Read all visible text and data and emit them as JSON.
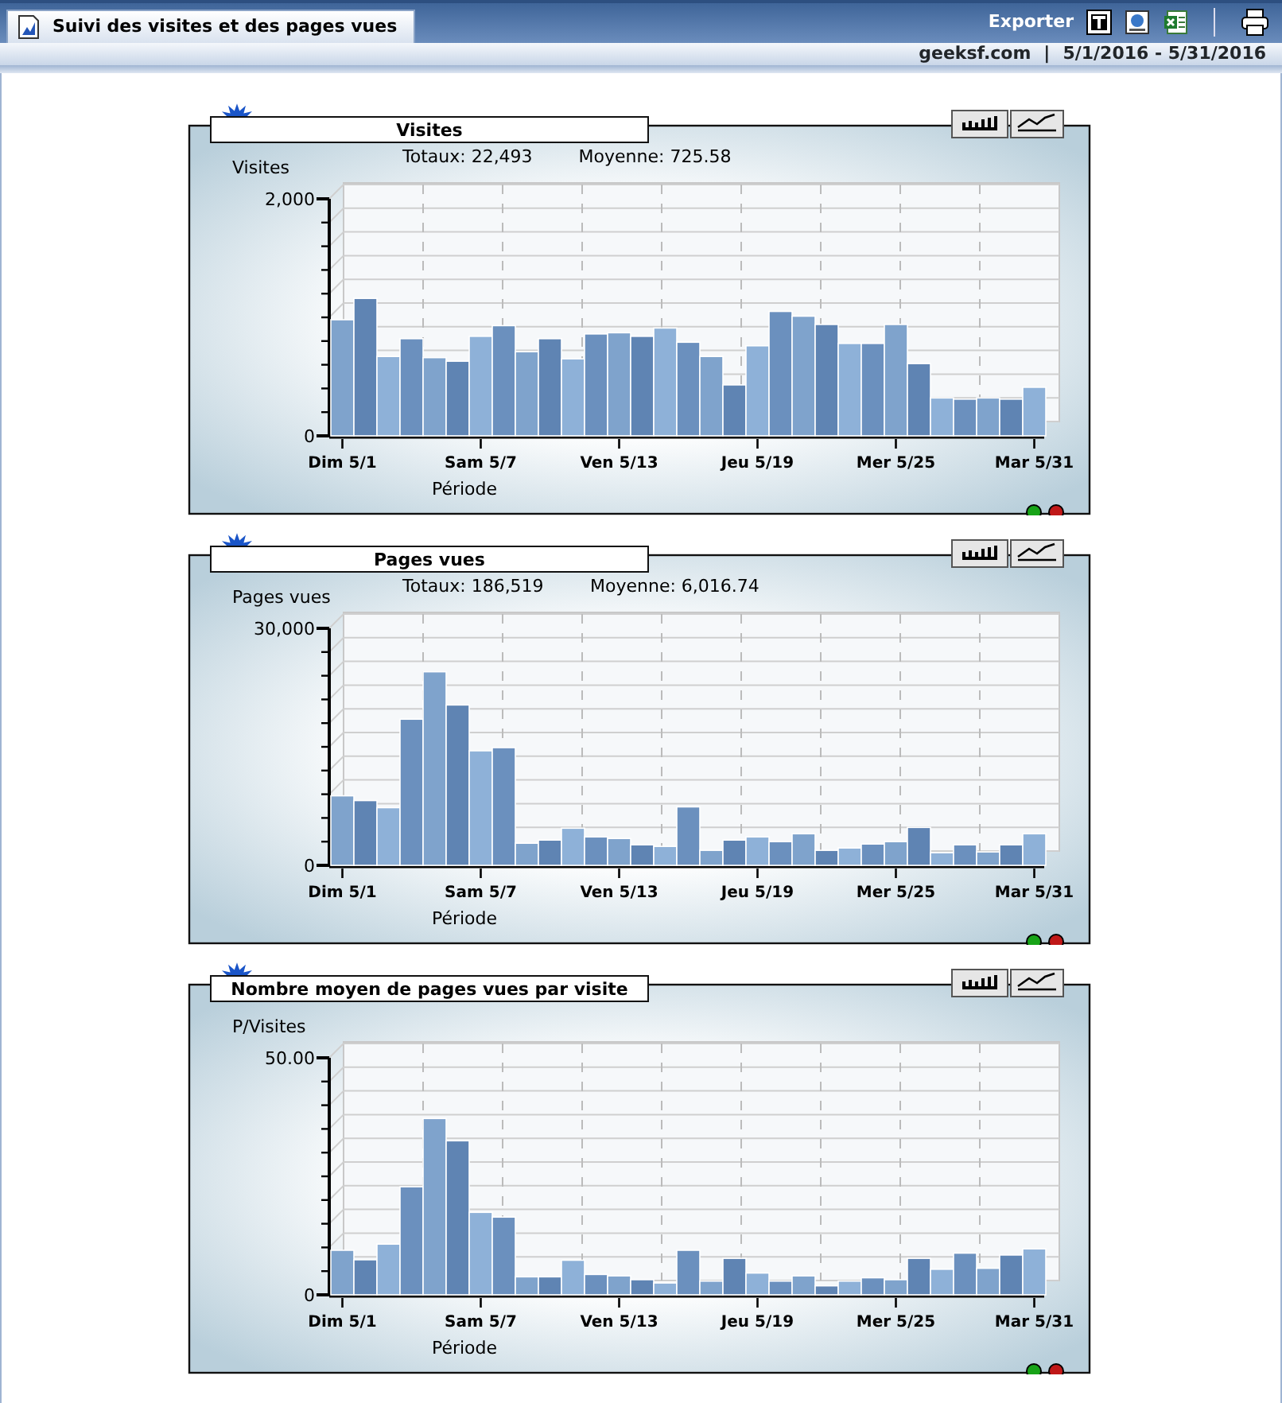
{
  "header": {
    "tab": {
      "label": "Suivi des visites et des pages vues",
      "selected": true
    },
    "export_label": "Exporter",
    "site": "geeksf.com",
    "separator": "|",
    "date_range": "5/1/2016 - 5/31/2016"
  },
  "panels": [
    {
      "totals": "Totaux: 22,493",
      "average": "Moyenne: 725.58",
      "chart_data": {
        "type": "bar",
        "title": "Visites",
        "ylabel": "Visites",
        "xlabel": "Période",
        "ylim": [
          0,
          2000
        ],
        "yticks": [
          {
            "value": 0,
            "label": "0"
          },
          {
            "value": 2000,
            "label": "2,000"
          }
        ],
        "categories": [
          "Dim 5/1",
          null,
          null,
          null,
          null,
          null,
          "Sam 5/7",
          null,
          null,
          null,
          null,
          null,
          "Ven 5/13",
          null,
          null,
          null,
          null,
          null,
          "Jeu 5/19",
          null,
          null,
          null,
          null,
          null,
          "Mer 5/25",
          null,
          null,
          null,
          null,
          null,
          "Mar 5/31"
        ],
        "values": [
          980,
          1160,
          670,
          820,
          660,
          630,
          840,
          930,
          710,
          820,
          650,
          860,
          870,
          840,
          910,
          790,
          670,
          430,
          760,
          1050,
          1010,
          940,
          780,
          780,
          940,
          610,
          320,
          310,
          320,
          310,
          410
        ]
      }
    },
    {
      "totals": "Totaux: 186,519",
      "average": "Moyenne: 6,016.74",
      "chart_data": {
        "type": "bar",
        "title": "Pages vues",
        "ylabel": "Pages vues",
        "xlabel": "Période",
        "ylim": [
          0,
          30000
        ],
        "yticks": [
          {
            "value": 0,
            "label": "0"
          },
          {
            "value": 30000,
            "label": "30,000"
          }
        ],
        "categories": [
          "Dim 5/1",
          null,
          null,
          null,
          null,
          null,
          "Sam 5/7",
          null,
          null,
          null,
          null,
          null,
          "Ven 5/13",
          null,
          null,
          null,
          null,
          null,
          "Jeu 5/19",
          null,
          null,
          null,
          null,
          null,
          "Mer 5/25",
          null,
          null,
          null,
          null,
          null,
          "Mar 5/31"
        ],
        "values": [
          8800,
          8200,
          7300,
          18500,
          24500,
          20300,
          14500,
          14900,
          2800,
          3200,
          4700,
          3600,
          3400,
          2600,
          2400,
          7400,
          1900,
          3200,
          3600,
          3000,
          4000,
          1900,
          2200,
          2700,
          3000,
          4800,
          1600,
          2600,
          1700,
          2600,
          4000
        ]
      }
    },
    {
      "chart_data": {
        "type": "bar",
        "title": "Nombre moyen de pages vues par visite",
        "ylabel": "P/Visites",
        "xlabel": "Période",
        "ylim": [
          0,
          50
        ],
        "yticks": [
          {
            "value": 0,
            "label": "0"
          },
          {
            "value": 50,
            "label": "50.00"
          }
        ],
        "categories": [
          "Dim 5/1",
          null,
          null,
          null,
          null,
          null,
          "Sam 5/7",
          null,
          null,
          null,
          null,
          null,
          "Ven 5/13",
          null,
          null,
          null,
          null,
          null,
          "Jeu 5/19",
          null,
          null,
          null,
          null,
          null,
          "Mer 5/25",
          null,
          null,
          null,
          null,
          null,
          "Mar 5/31"
        ],
        "values": [
          9.4,
          7.4,
          10.7,
          22.8,
          37.2,
          32.5,
          17.4,
          16.4,
          3.8,
          3.8,
          7.3,
          4.3,
          4.0,
          3.2,
          2.5,
          9.4,
          2.9,
          7.7,
          4.6,
          2.9,
          4.0,
          1.9,
          2.9,
          3.6,
          3.2,
          7.7,
          5.4,
          8.8,
          5.6,
          8.4,
          9.7
        ]
      }
    }
  ]
}
